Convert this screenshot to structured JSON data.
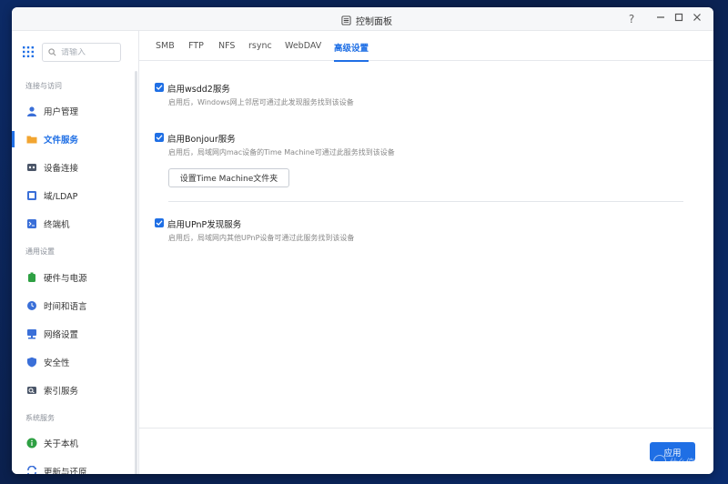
{
  "window": {
    "title": "控制面板",
    "help": "?",
    "accent_color": "#1f6fe5"
  },
  "sidebar": {
    "search_placeholder": "请输入",
    "sections": [
      {
        "label": "连接与访问"
      },
      {
        "label": "通用设置"
      },
      {
        "label": "系统服务"
      }
    ],
    "items": [
      {
        "label": "用户管理",
        "icon": "user-icon"
      },
      {
        "label": "文件服务",
        "icon": "folder-icon",
        "active": true
      },
      {
        "label": "设备连接",
        "icon": "device-icon"
      },
      {
        "label": "域/LDAP",
        "icon": "domain-icon"
      },
      {
        "label": "终端机",
        "icon": "terminal-icon"
      },
      {
        "label": "硬件与电源",
        "icon": "hardware-icon"
      },
      {
        "label": "时间和语言",
        "icon": "clock-icon"
      },
      {
        "label": "网络设置",
        "icon": "network-icon"
      },
      {
        "label": "安全性",
        "icon": "shield-icon"
      },
      {
        "label": "索引服务",
        "icon": "index-icon"
      },
      {
        "label": "关于本机",
        "icon": "info-icon"
      },
      {
        "label": "更新与还原",
        "icon": "update-icon"
      }
    ]
  },
  "tabs": [
    {
      "label": "SMB"
    },
    {
      "label": "FTP"
    },
    {
      "label": "NFS"
    },
    {
      "label": "rsync"
    },
    {
      "label": "WebDAV"
    },
    {
      "label": "高级设置",
      "active": true
    }
  ],
  "options": [
    {
      "label": "启用wsdd2服务",
      "checked": true,
      "desc": "启用后，Windows网上邻居可通过此发现服务找到该设备"
    },
    {
      "label": "启用Bonjour服务",
      "checked": true,
      "desc": "启用后，局域网内mac设备的Time Machine可通过此服务找到该设备"
    },
    {
      "label": "启用UPnP发现服务",
      "checked": true,
      "desc": "启用后，局域网内其他UPnP设备可通过此服务找到该设备"
    }
  ],
  "time_machine_button": "设置Time Machine文件夹",
  "footer": {
    "apply_label": "应用"
  },
  "watermark": "什么值得买"
}
